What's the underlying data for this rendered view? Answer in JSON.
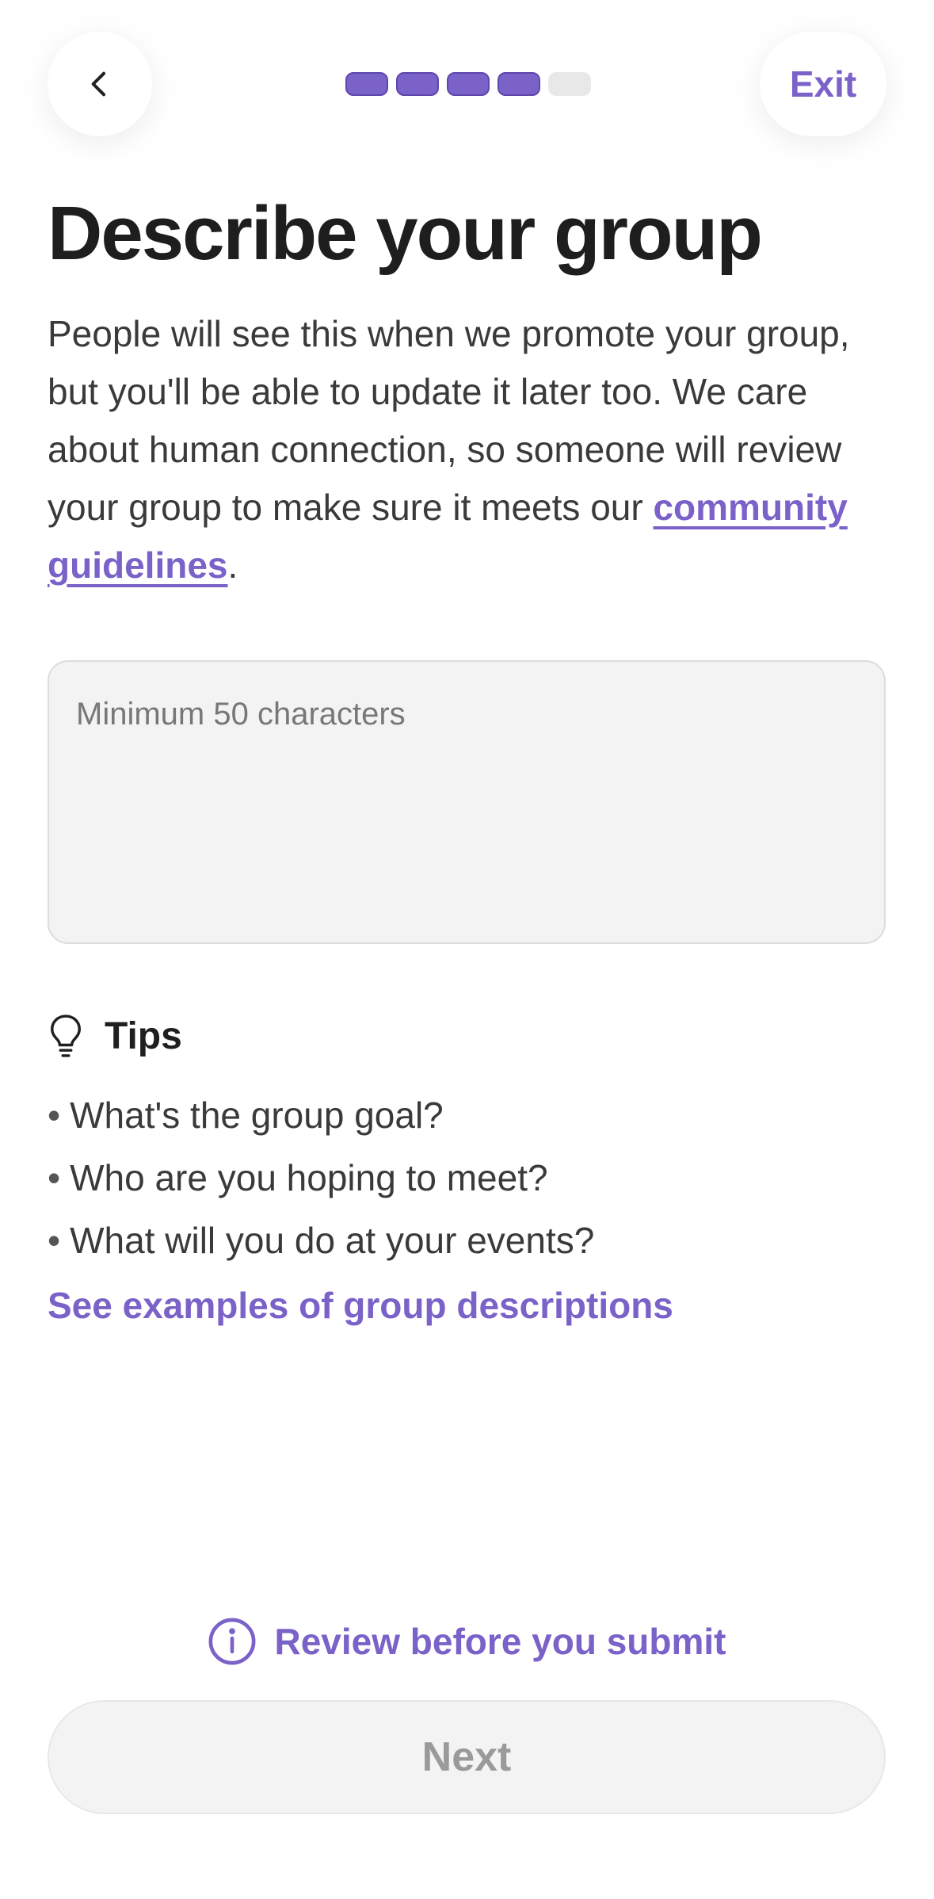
{
  "header": {
    "back_icon": "chevron-left-icon",
    "exit_label": "Exit",
    "progress": {
      "steps_total": 5,
      "steps_completed": 4,
      "active_color": "#7a62c8",
      "inactive_color": "#e8e8e8"
    }
  },
  "main": {
    "title": "Describe your group",
    "description": "People will see this when we promote your group, but you'll be able to update it later too. We care about human connection, so someone will review your group to make sure it meets our ",
    "guidelines_link": "community guidelines",
    "description_end": ".",
    "description_field": {
      "value": "",
      "placeholder": "Minimum 50 characters"
    },
    "tips": {
      "icon": "lightbulb-icon",
      "title": "Tips",
      "items": [
        "What's the group goal?",
        "Who are you hoping to meet?",
        "What will you do at your events?"
      ],
      "examples_link": "See examples of group descriptions"
    }
  },
  "footer": {
    "review_icon": "info-icon",
    "review_label": "Review before you submit",
    "next_label": "Next"
  },
  "colors": {
    "accent": "#7a62c8",
    "text": "#1f1f1f",
    "muted_text": "#3a3a3a",
    "disabled_text": "#9a9a9a",
    "field_background": "#f3f3f3"
  }
}
